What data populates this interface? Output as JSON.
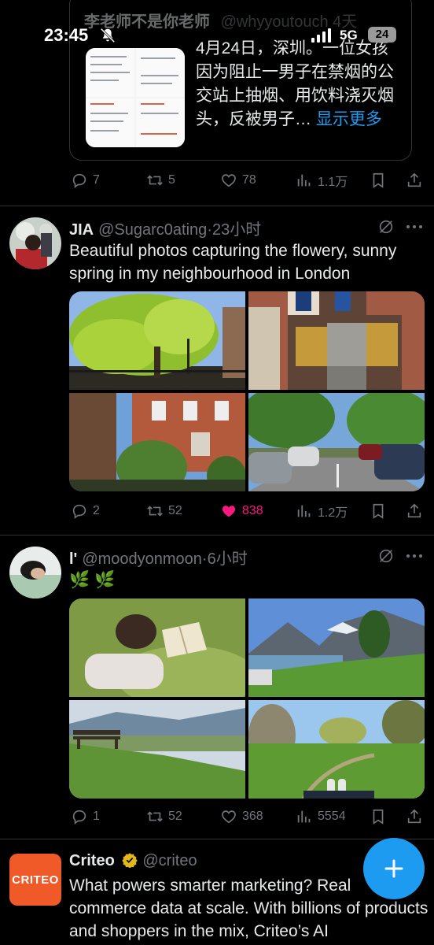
{
  "status": {
    "time": "23:45",
    "network": "5G",
    "battery": "24"
  },
  "top_tweet": {
    "quote": {
      "name": "李老师不是你老师",
      "handle": "@whyyoutouch",
      "age": "4天",
      "text": "4月24日，深圳。一位女孩因为阻止一男子在禁烟的公交站上抽烟、用饮料浇灭烟头，反被男子…",
      "more": "显示更多"
    },
    "stats": {
      "replies": "7",
      "reposts": "5",
      "likes": "78",
      "views": "1.1万"
    }
  },
  "tweets": [
    {
      "name": "JIA",
      "handle": "@Sugarc0ating",
      "age": "·23小时",
      "text": "Beautiful photos capturing the flowery, sunny spring in my neighbourhood in London",
      "stats": {
        "replies": "2",
        "reposts": "52",
        "likes": "838",
        "views": "1.2万"
      }
    },
    {
      "name": "l'",
      "handle": "@moodyonmoon",
      "age": "·6小时",
      "text": "🌿 🌿",
      "stats": {
        "replies": "1",
        "reposts": "52",
        "likes": "368",
        "views": "5554"
      }
    }
  ],
  "ad": {
    "logo": "CRITEO",
    "name": "Criteo",
    "handle": "@criteo",
    "text": "What powers smarter marketing? Real commerce data at scale. With billions of products and shoppers in the mix, Criteo’s AI"
  },
  "colors": {
    "accent": "#1d9bf0",
    "like": "#f91880",
    "muted": "#71767b",
    "divider": "#2f3336",
    "brand": "#f05a28"
  }
}
